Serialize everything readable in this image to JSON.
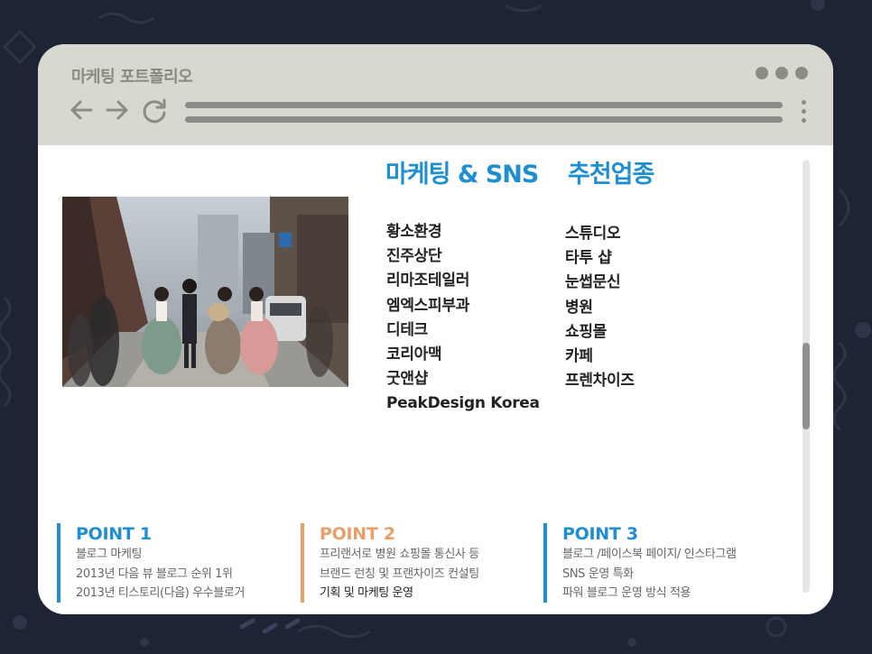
{
  "window": {
    "title": "마케팅 포트폴리오"
  },
  "headings": {
    "marketing": "마케팅 & SNS",
    "recommend": "추천업종"
  },
  "clients_left": [
    "황소환경",
    "진주상단",
    "리마조테일러",
    "엠엑스피부과",
    "디테크",
    "코리아맥",
    "굿앤샵",
    "PeakDesign Korea"
  ],
  "clients_right": [
    "스튜디오",
    "타투 샵",
    "눈썹문신",
    "병원",
    "쇼핑몰",
    "카페",
    "프렌차이즈"
  ],
  "points": [
    {
      "title": "POINT 1",
      "color": "#1f8fd1",
      "lines": [
        "블로그 마케팅",
        "2013년 다음 뷰 블로그 순위 1위",
        "2013년 티스토리(다음) 우수블로거"
      ]
    },
    {
      "title": "POINT 2",
      "color": "#e8a06a",
      "lines": [
        "프리랜서로 병원 쇼핑몰 통신사 등",
        "브랜드 런칭 및 프랜차이즈 컨설팅",
        "기획 및 마케팅 운영"
      ]
    },
    {
      "title": "POINT 3",
      "color": "#1f8fd1",
      "lines": [
        "블로그 /페이스북 페이지/ 인스타그램",
        "SNS 운영 특화",
        "파워 블로그 운영 방식 적용"
      ]
    }
  ],
  "icons": {
    "back": "arrow-left-icon",
    "forward": "arrow-right-icon",
    "reload": "reload-icon",
    "menu": "kebab-menu-icon"
  },
  "colors": {
    "background": "#1f2435",
    "chrome": "#d8d8d0",
    "accent_blue": "#1f8fd1",
    "accent_orange": "#e8a06a"
  }
}
